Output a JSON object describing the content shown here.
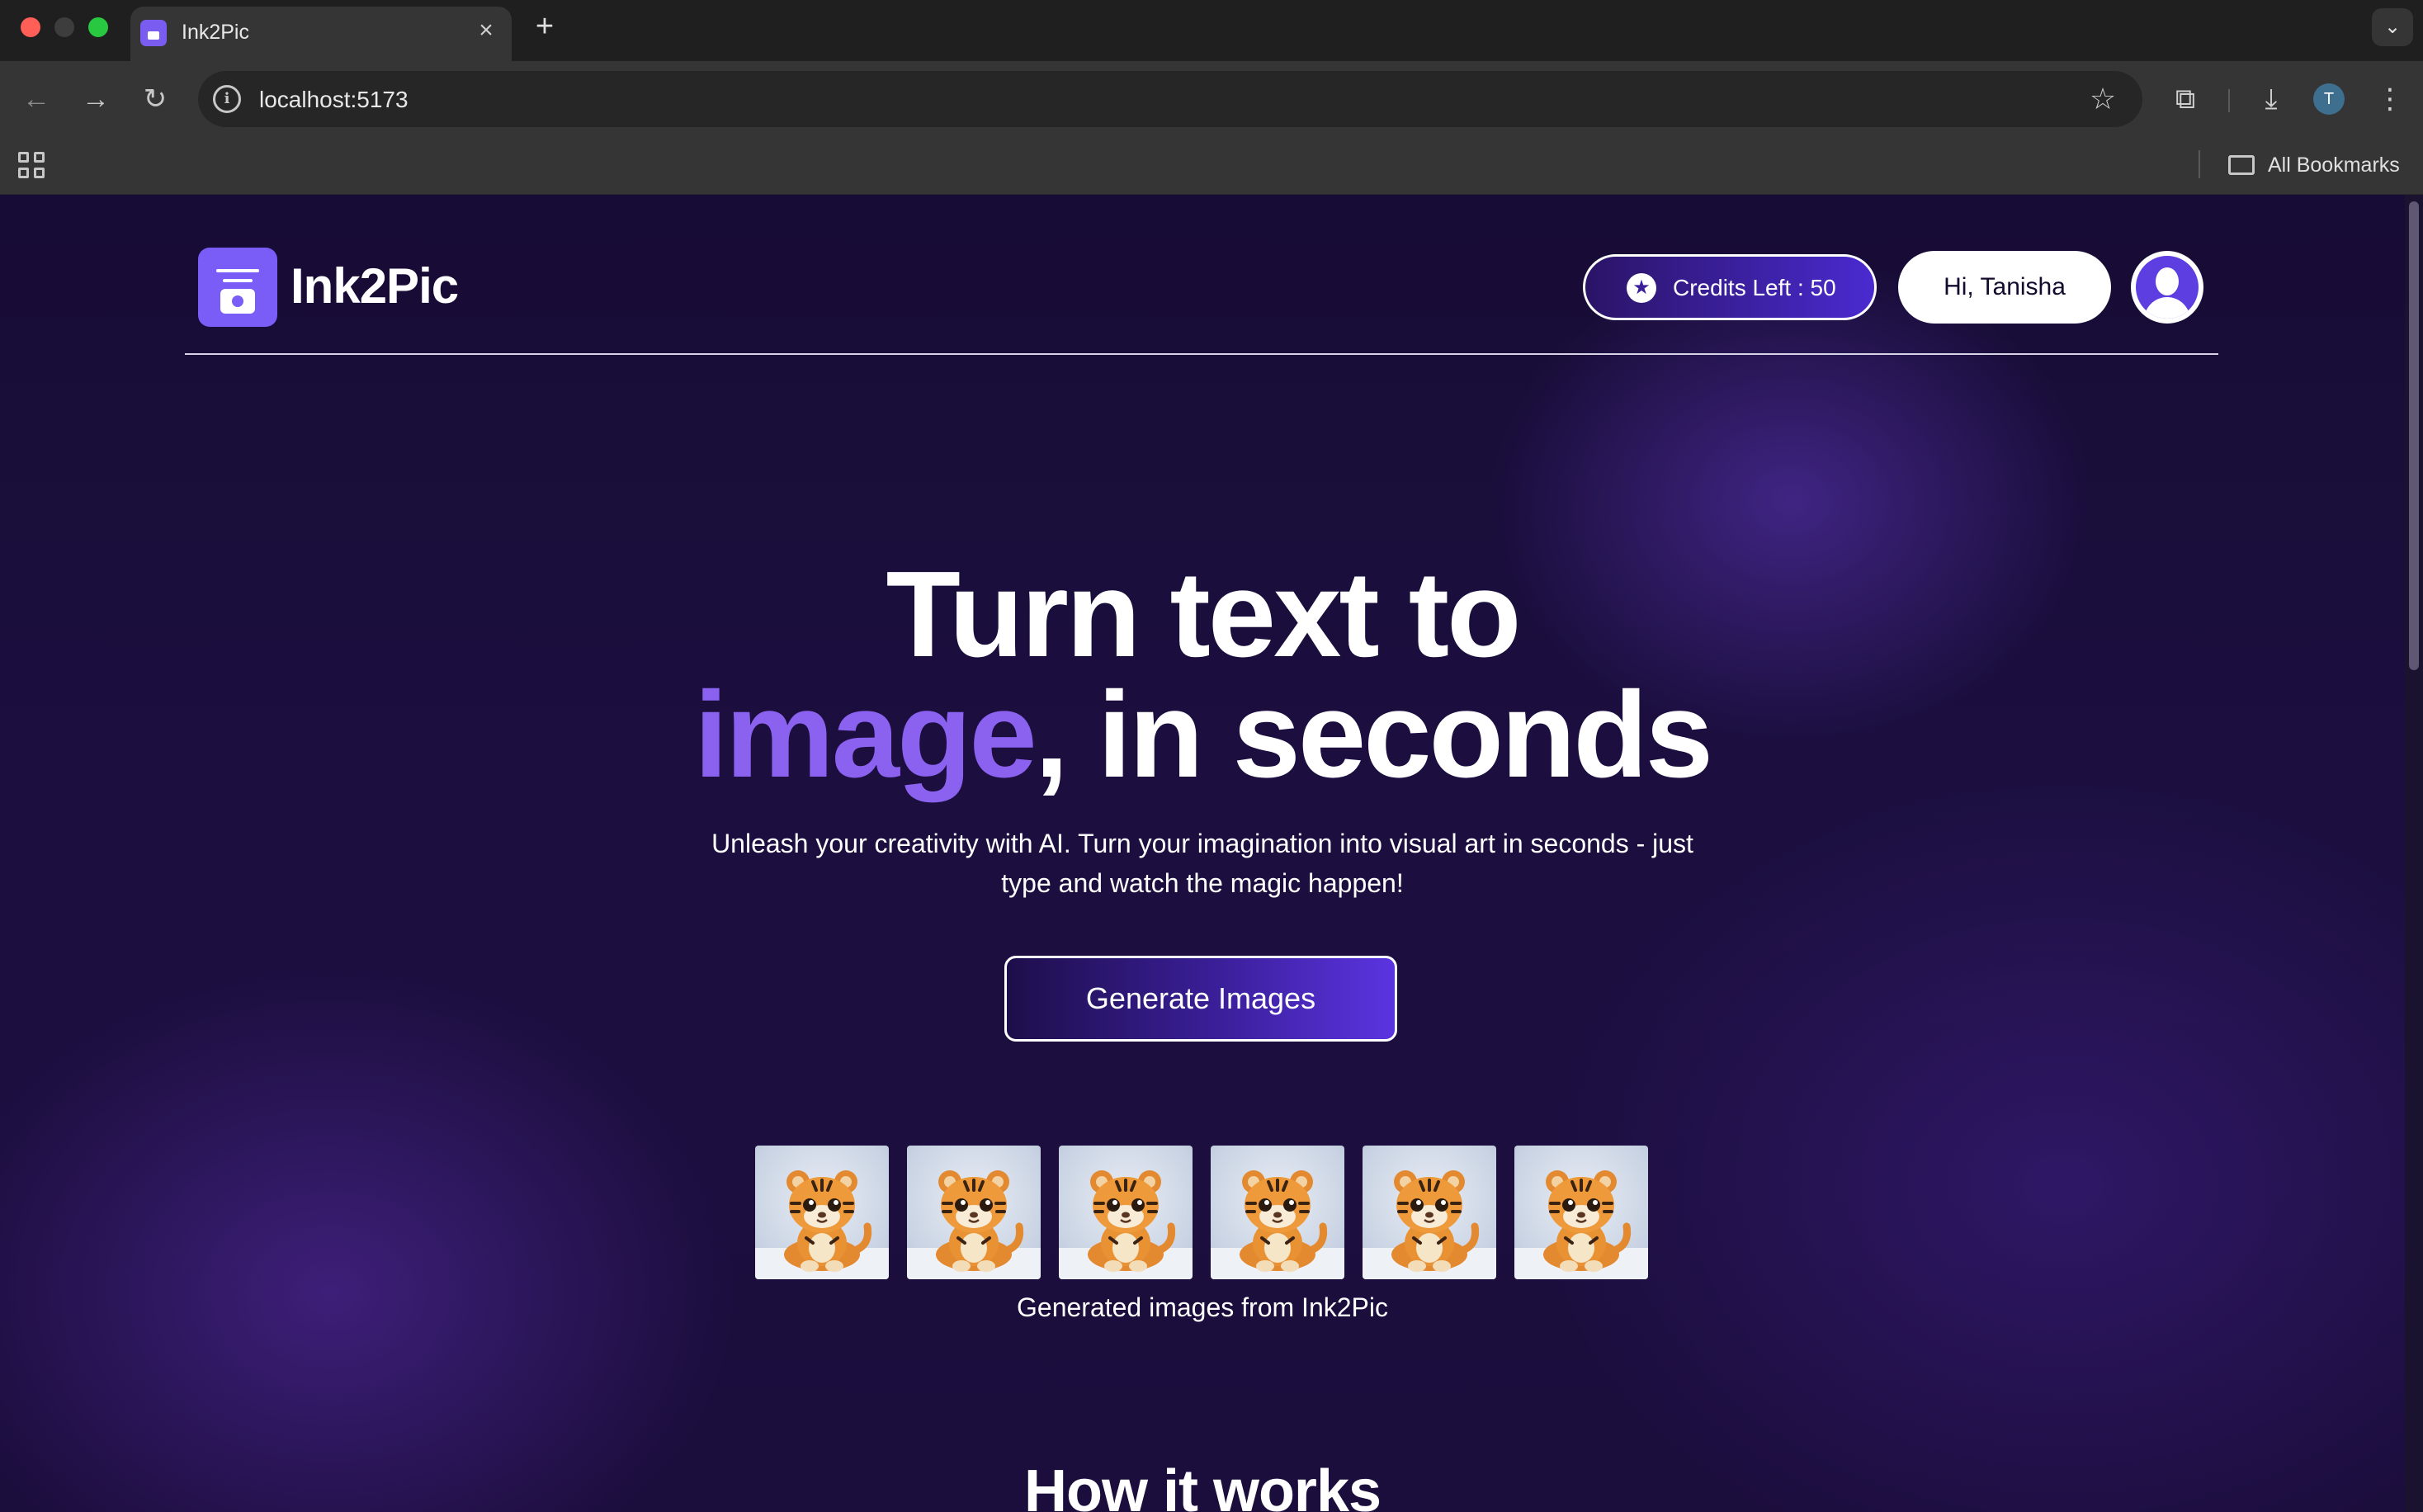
{
  "browser": {
    "tab_title": "Ink2Pic",
    "tab_close": "×",
    "new_tab": "+",
    "url": "localhost:5173",
    "profile_initial": "T",
    "bookmarks_label": "All Bookmarks"
  },
  "header": {
    "logo_text": "Ink2Pic",
    "credits_label": "Credits Left : 50",
    "greeting": "Hi, Tanisha"
  },
  "hero": {
    "line1": "Turn text to",
    "line2_accent": "image",
    "line2_rest": ", in seconds",
    "subtitle": "Unleash your creativity with AI. Turn your imagination into visual art in seconds - just type and watch the magic happen!",
    "cta_label": "Generate Images"
  },
  "gallery": {
    "image_count": 6,
    "caption": "Generated images from Ink2Pic"
  },
  "how_it_works": {
    "title": "How it works"
  },
  "colors": {
    "accent": "#8b62f0",
    "brand": "#7a5cf6",
    "background": "#1b0f3a"
  },
  "icons": {
    "credits": "star-icon",
    "logo": "camera-logo-icon",
    "avatar": "user-avatar-icon"
  }
}
